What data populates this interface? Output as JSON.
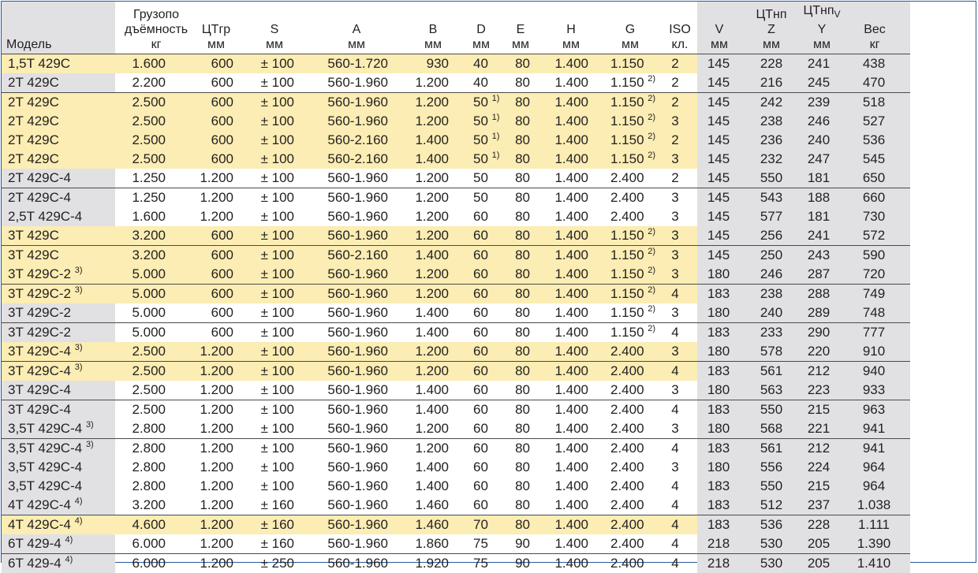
{
  "headers": {
    "model": "Модель",
    "load_1": "Грузопо",
    "load_2": "дъёмность",
    "load_3": "кг",
    "ctgr_1": "ЦТгр",
    "ctgr_2": "мм",
    "s_1": "S",
    "s_2": "мм",
    "a_1": "A",
    "a_2": "мм",
    "b_1": "B",
    "b_2": "мм",
    "d_1": "D",
    "d_2": "мм",
    "e_1": "E",
    "e_2": "мм",
    "h_1": "H",
    "h_2": "мм",
    "g_1": "G",
    "g_2": "мм",
    "iso_1": "ISO",
    "iso_2": "кл.",
    "v_1": "V",
    "v_2": "мм",
    "z_0": "ЦТнп",
    "z_1": "Z",
    "z_2": "мм",
    "y_0": "ЦТнп",
    "y_0_sub": "V",
    "y_1": "Y",
    "y_2": "мм",
    "w_1": "Вес",
    "w_2": "кг"
  },
  "rows": [
    {
      "model": "1,5T 429C",
      "msup": "",
      "load": "1.600",
      "ctgr": "600",
      "s": "± 100",
      "a": "560-1.720",
      "b": "930",
      "d": "40",
      "dsup": "",
      "e": "80",
      "h": "1.400",
      "g": "1.150",
      "gsup": "",
      "iso": "2",
      "v": "145",
      "z": "228",
      "y": "241",
      "w": "438",
      "bg": "yellow"
    },
    {
      "model": "2T 429C",
      "msup": "",
      "load": "2.200",
      "ctgr": "600",
      "s": "± 100",
      "a": "560-1.960",
      "b": "1.200",
      "d": "40",
      "dsup": "",
      "e": "80",
      "h": "1.400",
      "g": "1.150",
      "gsup": "2)",
      "iso": "2",
      "v": "145",
      "z": "216",
      "y": "245",
      "w": "470",
      "bg": "white"
    },
    {
      "model": "2T 429C",
      "msup": "",
      "load": "2.500",
      "ctgr": "600",
      "s": "± 100",
      "a": "560-1.960",
      "b": "1.200",
      "d": "50",
      "dsup": "1)",
      "e": "80",
      "h": "1.400",
      "g": "1.150",
      "gsup": "2)",
      "iso": "2",
      "v": "145",
      "z": "242",
      "y": "239",
      "w": "518",
      "bg": "yellow"
    },
    {
      "model": "2T 429C",
      "msup": "",
      "load": "2.500",
      "ctgr": "600",
      "s": "± 100",
      "a": "560-1.960",
      "b": "1.200",
      "d": "50",
      "dsup": "1)",
      "e": "80",
      "h": "1.400",
      "g": "1.150",
      "gsup": "2)",
      "iso": "3",
      "v": "145",
      "z": "238",
      "y": "246",
      "w": "527",
      "bg": "yellow"
    },
    {
      "model": "2T 429C",
      "msup": "",
      "load": "2.500",
      "ctgr": "600",
      "s": "± 100",
      "a": "560-2.160",
      "b": "1.400",
      "d": "50",
      "dsup": "1)",
      "e": "80",
      "h": "1.400",
      "g": "1.150",
      "gsup": "2)",
      "iso": "2",
      "v": "145",
      "z": "236",
      "y": "240",
      "w": "536",
      "bg": "yellow"
    },
    {
      "model": "2T 429C",
      "msup": "",
      "load": "2.500",
      "ctgr": "600",
      "s": "± 100",
      "a": "560-2.160",
      "b": "1.400",
      "d": "50",
      "dsup": "1)",
      "e": "80",
      "h": "1.400",
      "g": "1.150",
      "gsup": "2)",
      "iso": "3",
      "v": "145",
      "z": "232",
      "y": "247",
      "w": "545",
      "bg": "yellow"
    },
    {
      "model": "2T 429C-4",
      "msup": "",
      "load": "1.250",
      "ctgr": "1.200",
      "s": "± 100",
      "a": "560-1.960",
      "b": "1.200",
      "d": "50",
      "dsup": "",
      "e": "80",
      "h": "1.400",
      "g": "2.400",
      "gsup": "",
      "iso": "2",
      "v": "145",
      "z": "550",
      "y": "181",
      "w": "650",
      "bg": "white"
    },
    {
      "model": "2T 429C-4",
      "msup": "",
      "load": "1.250",
      "ctgr": "1.200",
      "s": "± 100",
      "a": "560-1.960",
      "b": "1.200",
      "d": "50",
      "dsup": "",
      "e": "80",
      "h": "1.400",
      "g": "2.400",
      "gsup": "",
      "iso": "3",
      "v": "145",
      "z": "543",
      "y": "188",
      "w": "660",
      "bg": "white"
    },
    {
      "model": "2,5T 429C-4",
      "msup": "",
      "load": "1.600",
      "ctgr": "1.200",
      "s": "± 100",
      "a": "560-1.960",
      "b": "1.200",
      "d": "60",
      "dsup": "",
      "e": "80",
      "h": "1.400",
      "g": "2.400",
      "gsup": "",
      "iso": "3",
      "v": "145",
      "z": "577",
      "y": "181",
      "w": "730",
      "bg": "white"
    },
    {
      "model": "3T 429C",
      "msup": "",
      "load": "3.200",
      "ctgr": "600",
      "s": "± 100",
      "a": "560-1.960",
      "b": "1.200",
      "d": "60",
      "dsup": "",
      "e": "80",
      "h": "1.400",
      "g": "1.150",
      "gsup": "2)",
      "iso": "3",
      "v": "145",
      "z": "256",
      "y": "241",
      "w": "572",
      "bg": "yellow"
    },
    {
      "model": "3T 429C",
      "msup": "",
      "load": "3.200",
      "ctgr": "600",
      "s": "± 100",
      "a": "560-2.160",
      "b": "1.400",
      "d": "60",
      "dsup": "",
      "e": "80",
      "h": "1.400",
      "g": "1.150",
      "gsup": "2)",
      "iso": "3",
      "v": "145",
      "z": "250",
      "y": "243",
      "w": "590",
      "bg": "yellow"
    },
    {
      "model": "3T 429C-2",
      "msup": "3)",
      "load": "5.000",
      "ctgr": "600",
      "s": "± 100",
      "a": "560-1.960",
      "b": "1.200",
      "d": "60",
      "dsup": "",
      "e": "80",
      "h": "1.400",
      "g": "1.150",
      "gsup": "2)",
      "iso": "3",
      "v": "180",
      "z": "246",
      "y": "287",
      "w": "720",
      "bg": "yellow"
    },
    {
      "model": "3T 429C-2",
      "msup": "3)",
      "load": "5.000",
      "ctgr": "600",
      "s": "± 100",
      "a": "560-1.960",
      "b": "1.200",
      "d": "60",
      "dsup": "",
      "e": "80",
      "h": "1.400",
      "g": "1.150",
      "gsup": "2)",
      "iso": "4",
      "v": "183",
      "z": "238",
      "y": "288",
      "w": "749",
      "bg": "yellow"
    },
    {
      "model": "3T 429C-2",
      "msup": "",
      "load": "5.000",
      "ctgr": "600",
      "s": "± 100",
      "a": "560-1.960",
      "b": "1.400",
      "d": "60",
      "dsup": "",
      "e": "80",
      "h": "1.400",
      "g": "1.150",
      "gsup": "2)",
      "iso": "3",
      "v": "180",
      "z": "240",
      "y": "289",
      "w": "748",
      "bg": "white"
    },
    {
      "model": "3T 429C-2",
      "msup": "",
      "load": "5.000",
      "ctgr": "600",
      "s": "± 100",
      "a": "560-1.960",
      "b": "1.400",
      "d": "60",
      "dsup": "",
      "e": "80",
      "h": "1.400",
      "g": "1.150",
      "gsup": "2)",
      "iso": "4",
      "v": "183",
      "z": "233",
      "y": "290",
      "w": "777",
      "bg": "white"
    },
    {
      "model": "3T 429C-4",
      "msup": "3)",
      "load": "2.500",
      "ctgr": "1.200",
      "s": "± 100",
      "a": "560-1.960",
      "b": "1.200",
      "d": "60",
      "dsup": "",
      "e": "80",
      "h": "1.400",
      "g": "2.400",
      "gsup": "",
      "iso": "3",
      "v": "180",
      "z": "578",
      "y": "220",
      "w": "910",
      "bg": "yellow"
    },
    {
      "model": "3T 429C-4",
      "msup": "3)",
      "load": "2.500",
      "ctgr": "1.200",
      "s": "± 100",
      "a": "560-1.960",
      "b": "1.200",
      "d": "60",
      "dsup": "",
      "e": "80",
      "h": "1.400",
      "g": "2.400",
      "gsup": "",
      "iso": "4",
      "v": "183",
      "z": "561",
      "y": "212",
      "w": "940",
      "bg": "yellow"
    },
    {
      "model": "3T 429C-4",
      "msup": "",
      "load": "2.500",
      "ctgr": "1.200",
      "s": "± 100",
      "a": "560-1.960",
      "b": "1.400",
      "d": "60",
      "dsup": "",
      "e": "80",
      "h": "1.400",
      "g": "2.400",
      "gsup": "",
      "iso": "3",
      "v": "180",
      "z": "563",
      "y": "223",
      "w": "933",
      "bg": "white"
    },
    {
      "model": "3T 429C-4",
      "msup": "",
      "load": "2.500",
      "ctgr": "1.200",
      "s": "± 100",
      "a": "560-1.960",
      "b": "1.400",
      "d": "60",
      "dsup": "",
      "e": "80",
      "h": "1.400",
      "g": "2.400",
      "gsup": "",
      "iso": "4",
      "v": "183",
      "z": "550",
      "y": "215",
      "w": "963",
      "bg": "white"
    },
    {
      "model": "3,5T 429C-4",
      "msup": "3)",
      "load": "2.800",
      "ctgr": "1.200",
      "s": "± 100",
      "a": "560-1.960",
      "b": "1.200",
      "d": "60",
      "dsup": "",
      "e": "80",
      "h": "1.400",
      "g": "2.400",
      "gsup": "",
      "iso": "3",
      "v": "180",
      "z": "568",
      "y": "221",
      "w": "941",
      "bg": "white"
    },
    {
      "model": "3,5T 429C-4",
      "msup": "3)",
      "load": "2.800",
      "ctgr": "1.200",
      "s": "± 100",
      "a": "560-1.960",
      "b": "1.200",
      "d": "60",
      "dsup": "",
      "e": "80",
      "h": "1.400",
      "g": "2.400",
      "gsup": "",
      "iso": "4",
      "v": "183",
      "z": "561",
      "y": "212",
      "w": "941",
      "bg": "white"
    },
    {
      "model": "3,5T 429C-4",
      "msup": "",
      "load": "2.800",
      "ctgr": "1.200",
      "s": "± 100",
      "a": "560-1.960",
      "b": "1.400",
      "d": "60",
      "dsup": "",
      "e": "80",
      "h": "1.400",
      "g": "2.400",
      "gsup": "",
      "iso": "3",
      "v": "180",
      "z": "556",
      "y": "224",
      "w": "964",
      "bg": "white"
    },
    {
      "model": "3,5T 429C-4",
      "msup": "",
      "load": "2.800",
      "ctgr": "1.200",
      "s": "± 100",
      "a": "560-1.960",
      "b": "1.400",
      "d": "60",
      "dsup": "",
      "e": "80",
      "h": "1.400",
      "g": "2.400",
      "gsup": "",
      "iso": "4",
      "v": "183",
      "z": "550",
      "y": "215",
      "w": "964",
      "bg": "white"
    },
    {
      "model": "4T 429C-4",
      "msup": "4)",
      "load": "3.200",
      "ctgr": "1.200",
      "s": "± 160",
      "a": "560-1.960",
      "b": "1.460",
      "d": "60",
      "dsup": "",
      "e": "80",
      "h": "1.400",
      "g": "2.400",
      "gsup": "",
      "iso": "4",
      "v": "183",
      "z": "512",
      "y": "237",
      "w": "1.038",
      "bg": "white"
    },
    {
      "model": "4T 429C-4",
      "msup": "4)",
      "load": "4.600",
      "ctgr": "1.200",
      "s": "± 160",
      "a": "560-1.960",
      "b": "1.460",
      "d": "70",
      "dsup": "",
      "e": "80",
      "h": "1.400",
      "g": "2.400",
      "gsup": "",
      "iso": "4",
      "v": "183",
      "z": "536",
      "y": "228",
      "w": "1.111",
      "bg": "yellow"
    },
    {
      "model": "6T 429-4",
      "msup": "4)",
      "load": "6.000",
      "ctgr": "1.200",
      "s": "± 160",
      "a": "560-1.960",
      "b": "1.860",
      "d": "75",
      "dsup": "",
      "e": "90",
      "h": "1.400",
      "g": "2.400",
      "gsup": "",
      "iso": "4",
      "v": "218",
      "z": "530",
      "y": "205",
      "w": "1.390",
      "bg": "white"
    },
    {
      "model": "6T 429-4",
      "msup": "4)",
      "load": "6.000",
      "ctgr": "1.200",
      "s": "± 250",
      "a": "560-1.960",
      "b": "1.920",
      "d": "75",
      "dsup": "",
      "e": "90",
      "h": "1.400",
      "g": "2.400",
      "gsup": "",
      "iso": "4",
      "v": "218",
      "z": "530",
      "y": "205",
      "w": "1.410",
      "bg": "white"
    }
  ],
  "group_separators_after_row": [
    1,
    6,
    9,
    11,
    13,
    15,
    17,
    19,
    23,
    25
  ],
  "colors": {
    "yellow_row": "#fbedb3",
    "grey_column": "#e1e1e3",
    "frame": "#2a5a9a",
    "separator": "#4a4a4a"
  }
}
